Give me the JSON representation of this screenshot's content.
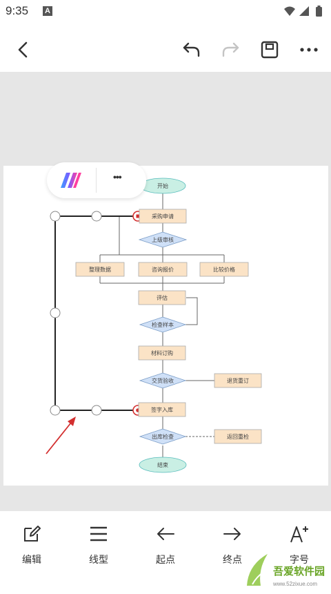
{
  "status_bar": {
    "time": "9:35",
    "notification_icon_letter": "A"
  },
  "toolbar": {
    "icons": [
      "back-arrow-icon",
      "undo-icon",
      "redo-icon",
      "save-icon",
      "more-icon"
    ]
  },
  "popup": {
    "more_label": "•••"
  },
  "flowchart": {
    "start": "开始",
    "apply": "采购申请",
    "approve": "上级审核",
    "collect": "整理数据",
    "inquiry": "咨询报价",
    "compare": "比较价格",
    "evaluate": "评估",
    "check_sample": "检查样本",
    "order": "材料订购",
    "delivery": "交货验收",
    "return_order": "退货重订",
    "warehouse": "签字入库",
    "out_check": "出库检查",
    "return_check": "返回重检",
    "end": "结束"
  },
  "bottom_bar": {
    "items": [
      {
        "label": "编辑"
      },
      {
        "label": "线型"
      },
      {
        "label": "起点"
      },
      {
        "label": "终点"
      },
      {
        "label": "字号"
      }
    ]
  },
  "watermark": {
    "brand": "吾爱软件园",
    "url": "www.52zixue.com"
  },
  "colors": {
    "accent_red": "#d32f2f",
    "diamond_fill": "#cfe0f7",
    "rect_fill": "#fbe3c6",
    "ellipse_fill": "#c9efe4"
  }
}
